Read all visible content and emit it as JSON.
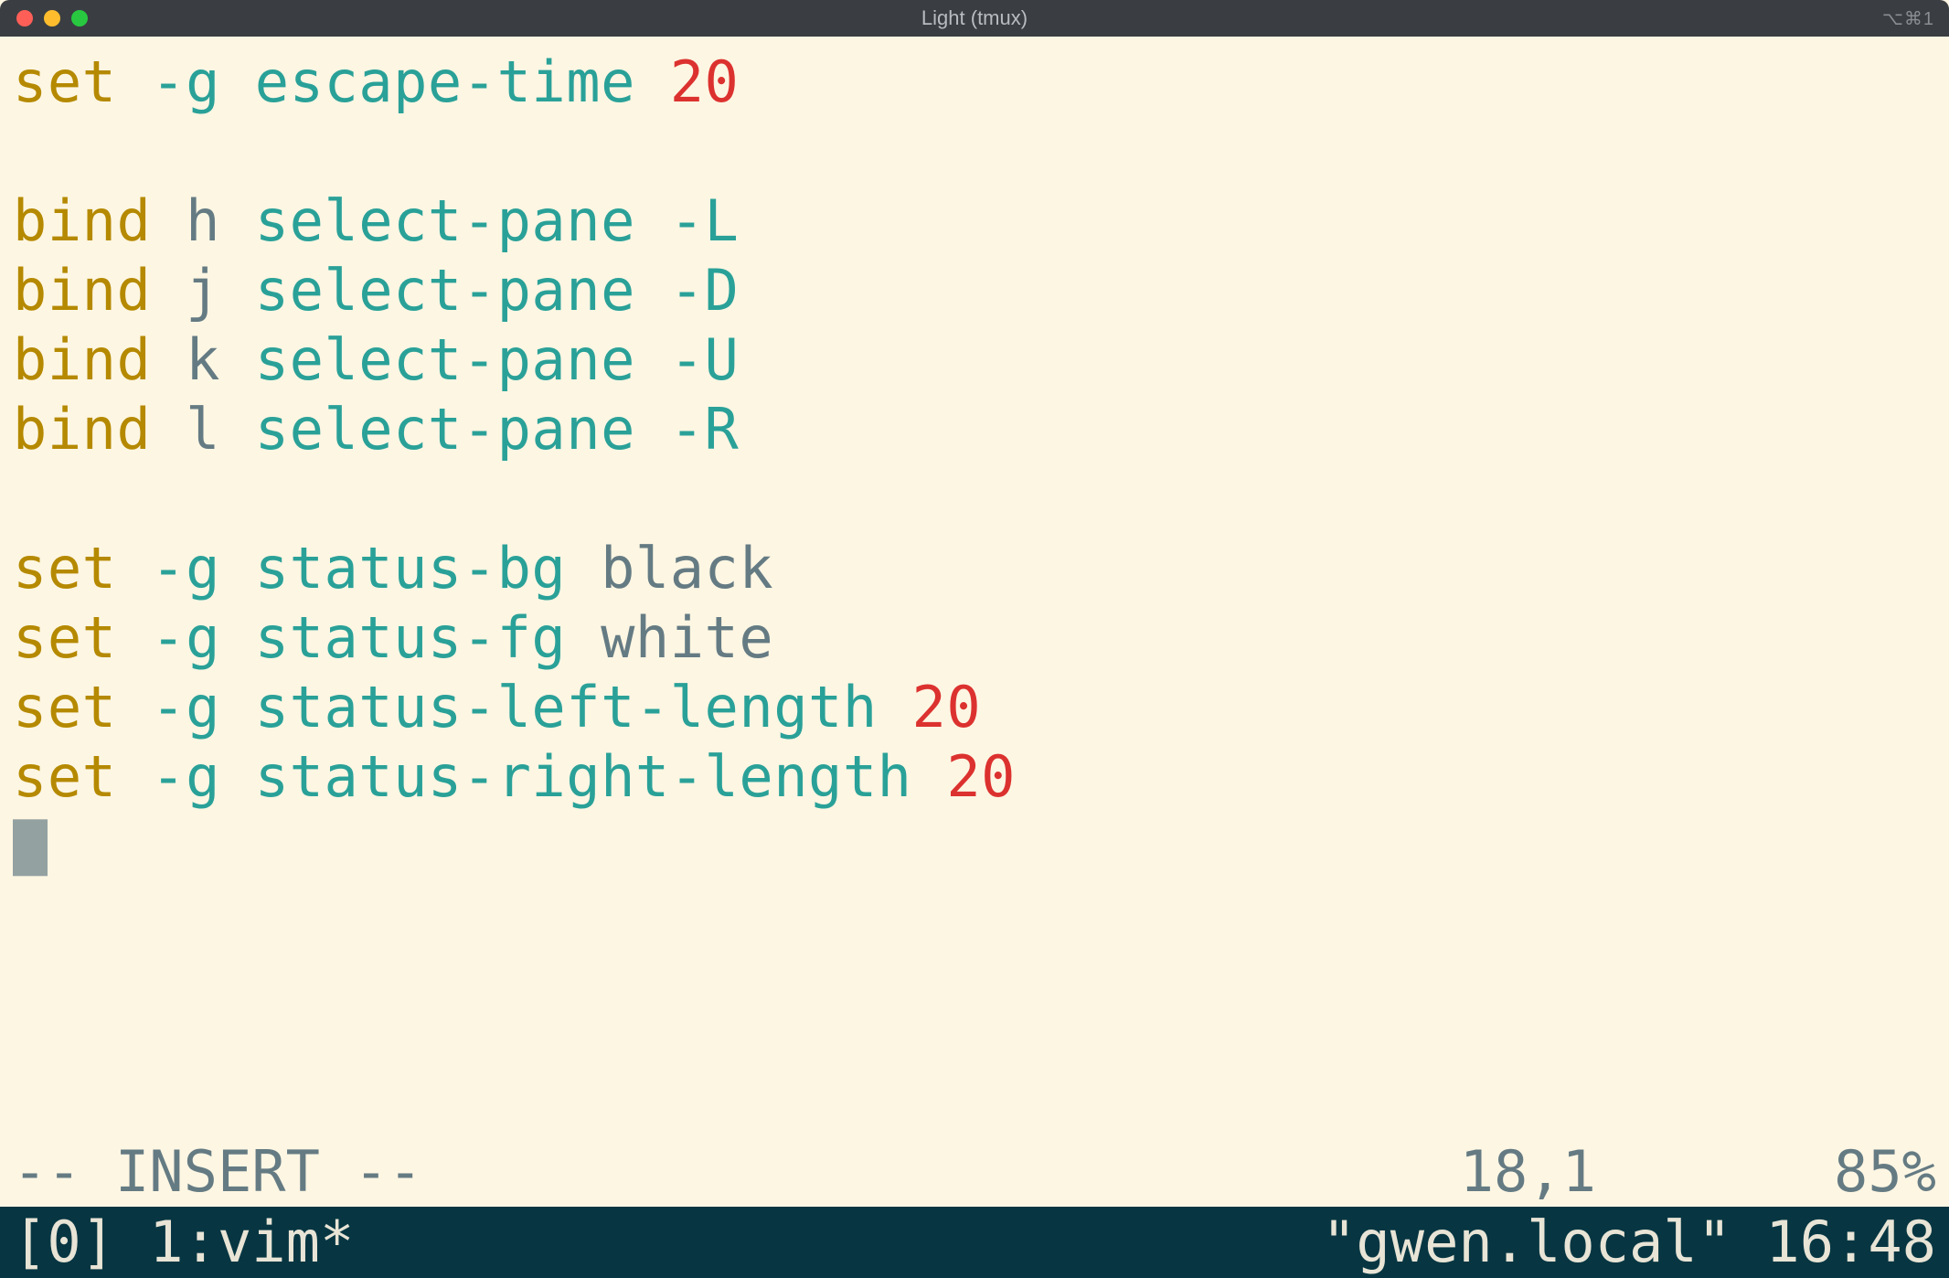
{
  "window": {
    "title": "Light (tmux)",
    "shortcut_hint": "⌥⌘1"
  },
  "editor": {
    "lines": [
      [
        {
          "t": "set",
          "c": "cmd"
        },
        {
          "t": " ",
          "c": "base"
        },
        {
          "t": "-g",
          "c": "opt"
        },
        {
          "t": " ",
          "c": "base"
        },
        {
          "t": "escape-time",
          "c": "opt"
        },
        {
          "t": " ",
          "c": "base"
        },
        {
          "t": "20",
          "c": "num"
        }
      ],
      [],
      [
        {
          "t": "bind",
          "c": "cmd"
        },
        {
          "t": " ",
          "c": "base"
        },
        {
          "t": "h",
          "c": "base"
        },
        {
          "t": " ",
          "c": "base"
        },
        {
          "t": "select-pane",
          "c": "opt"
        },
        {
          "t": " ",
          "c": "base"
        },
        {
          "t": "-L",
          "c": "opt"
        }
      ],
      [
        {
          "t": "bind",
          "c": "cmd"
        },
        {
          "t": " ",
          "c": "base"
        },
        {
          "t": "j",
          "c": "base"
        },
        {
          "t": " ",
          "c": "base"
        },
        {
          "t": "select-pane",
          "c": "opt"
        },
        {
          "t": " ",
          "c": "base"
        },
        {
          "t": "-D",
          "c": "opt"
        }
      ],
      [
        {
          "t": "bind",
          "c": "cmd"
        },
        {
          "t": " ",
          "c": "base"
        },
        {
          "t": "k",
          "c": "base"
        },
        {
          "t": " ",
          "c": "base"
        },
        {
          "t": "select-pane",
          "c": "opt"
        },
        {
          "t": " ",
          "c": "base"
        },
        {
          "t": "-U",
          "c": "opt"
        }
      ],
      [
        {
          "t": "bind",
          "c": "cmd"
        },
        {
          "t": " ",
          "c": "base"
        },
        {
          "t": "l",
          "c": "base"
        },
        {
          "t": " ",
          "c": "base"
        },
        {
          "t": "select-pane",
          "c": "opt"
        },
        {
          "t": " ",
          "c": "base"
        },
        {
          "t": "-R",
          "c": "opt"
        }
      ],
      [],
      [
        {
          "t": "set",
          "c": "cmd"
        },
        {
          "t": " ",
          "c": "base"
        },
        {
          "t": "-g",
          "c": "opt"
        },
        {
          "t": " ",
          "c": "base"
        },
        {
          "t": "status-bg",
          "c": "opt"
        },
        {
          "t": " ",
          "c": "base"
        },
        {
          "t": "black",
          "c": "base"
        }
      ],
      [
        {
          "t": "set",
          "c": "cmd"
        },
        {
          "t": " ",
          "c": "base"
        },
        {
          "t": "-g",
          "c": "opt"
        },
        {
          "t": " ",
          "c": "base"
        },
        {
          "t": "status-fg",
          "c": "opt"
        },
        {
          "t": " ",
          "c": "base"
        },
        {
          "t": "white",
          "c": "base"
        }
      ],
      [
        {
          "t": "set",
          "c": "cmd"
        },
        {
          "t": " ",
          "c": "base"
        },
        {
          "t": "-g",
          "c": "opt"
        },
        {
          "t": " ",
          "c": "base"
        },
        {
          "t": "status-left-length",
          "c": "opt"
        },
        {
          "t": " ",
          "c": "base"
        },
        {
          "t": "20",
          "c": "num"
        }
      ],
      [
        {
          "t": "set",
          "c": "cmd"
        },
        {
          "t": " ",
          "c": "base"
        },
        {
          "t": "-g",
          "c": "opt"
        },
        {
          "t": " ",
          "c": "base"
        },
        {
          "t": "status-right-length",
          "c": "opt"
        },
        {
          "t": " ",
          "c": "base"
        },
        {
          "t": "20",
          "c": "num"
        }
      ],
      [
        {
          "cursor": true
        }
      ],
      [],
      [],
      []
    ]
  },
  "vim": {
    "mode": "-- INSERT --",
    "position": "18,1",
    "percent": "85%"
  },
  "tmux": {
    "left": "[0] 1:vim*",
    "right": "\"gwen.local\" 16:48"
  },
  "colors": {
    "bg": "#fdf6e3",
    "cmd": "#b58900",
    "opt": "#2aa198",
    "num": "#dc322f",
    "base": "#657b83",
    "tmux_bg": "#073642",
    "tmux_fg": "#e8e4d6"
  }
}
